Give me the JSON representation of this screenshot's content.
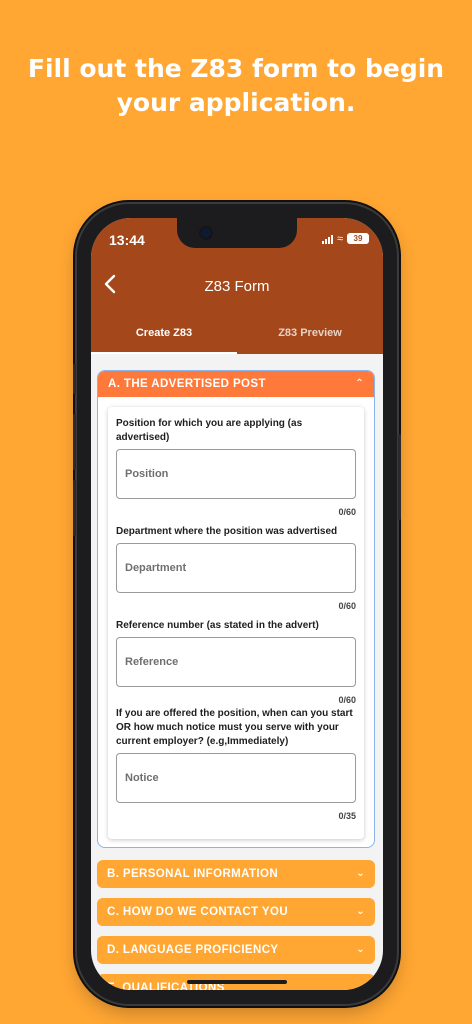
{
  "headline": "Fill out the Z83 form to begin your application.",
  "status": {
    "time": "13:44",
    "battery": "39"
  },
  "appbar": {
    "title": "Z83 Form"
  },
  "tabs": [
    "Create Z83",
    "Z83 Preview"
  ],
  "open_section": {
    "title": "A. THE ADVERTISED POST",
    "fields": [
      {
        "label": "Position for which you are applying (as advertised)",
        "placeholder": "Position",
        "counter": "0/60"
      },
      {
        "label": "Department where the position was advertised",
        "placeholder": "Department",
        "counter": "0/60"
      },
      {
        "label": "Reference number (as stated in the advert)",
        "placeholder": "Reference",
        "counter": "0/60"
      },
      {
        "label": "If you are offered the position, when can you start OR how much notice must you serve with your current employer? (e.g,Immediately)",
        "placeholder": "Notice",
        "counter": "0/35"
      }
    ]
  },
  "sections": [
    "B. PERSONAL INFORMATION",
    "C. HOW DO WE CONTACT YOU",
    "D. LANGUAGE PROFICIENCY",
    "E. QUALIFICATIONS"
  ],
  "colors": {
    "background": "#FFA633",
    "appbar": "#A4471A",
    "section_header_open": "#FF7A3A",
    "section_header": "#FFA633"
  },
  "icons": {
    "back": "chevron-left-icon",
    "collapse": "chevron-up-icon",
    "expand": "chevron-down-icon"
  }
}
